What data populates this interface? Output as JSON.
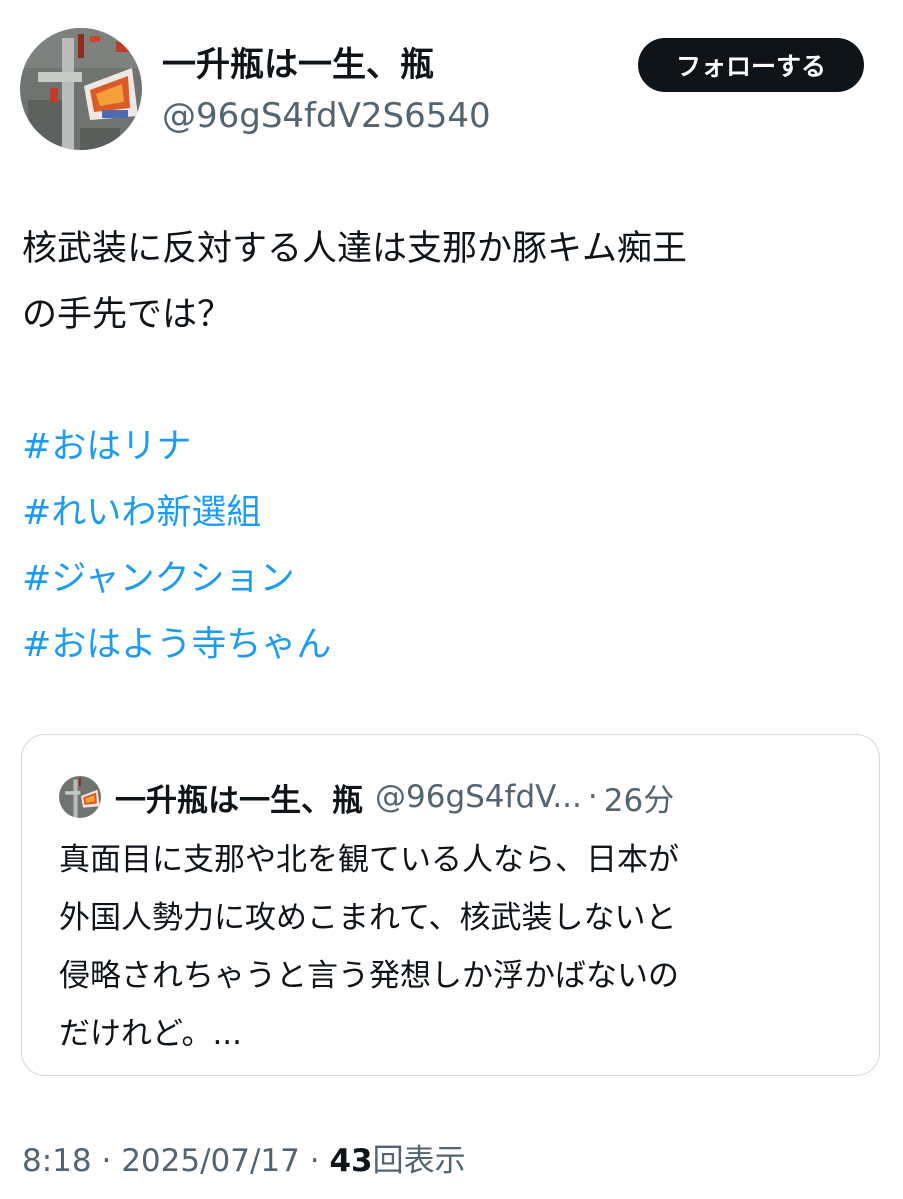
{
  "author": {
    "display_name": "一升瓶は一生、瓶",
    "handle": "@96gS4fdV2S6540",
    "avatar_icon": "abstract-painting-avatar-icon"
  },
  "follow_button": {
    "label": "フォローする"
  },
  "tweet": {
    "text_lines": [
      "核武装に反対する人達は支那か豚キム痴王",
      "の手先では？"
    ],
    "hashtags": [
      "#おはリナ",
      "#れいわ新選組",
      "#ジャンクション",
      "#おはよう寺ちゃん"
    ]
  },
  "quote": {
    "display_name": "一升瓶は一生、瓶",
    "handle": "@96gS4fdV...",
    "separator": "·",
    "time": "26分",
    "text_lines": [
      "真面目に支那や北を観ている人なら、日本が",
      "外国人勢力に攻めこまれて、核武装しないと",
      "侵略されちゃうと言う発想しか浮かばないの",
      "だけれど。..."
    ]
  },
  "meta": {
    "time": "8:18",
    "separator": "·",
    "date": "2025/07/17",
    "views_count": "43",
    "views_label": "回表示"
  },
  "colors": {
    "text": "#0f1419",
    "secondary": "#536471",
    "link": "#1d9bf0",
    "border": "#cfd9de",
    "button_bg": "#0f1419"
  }
}
